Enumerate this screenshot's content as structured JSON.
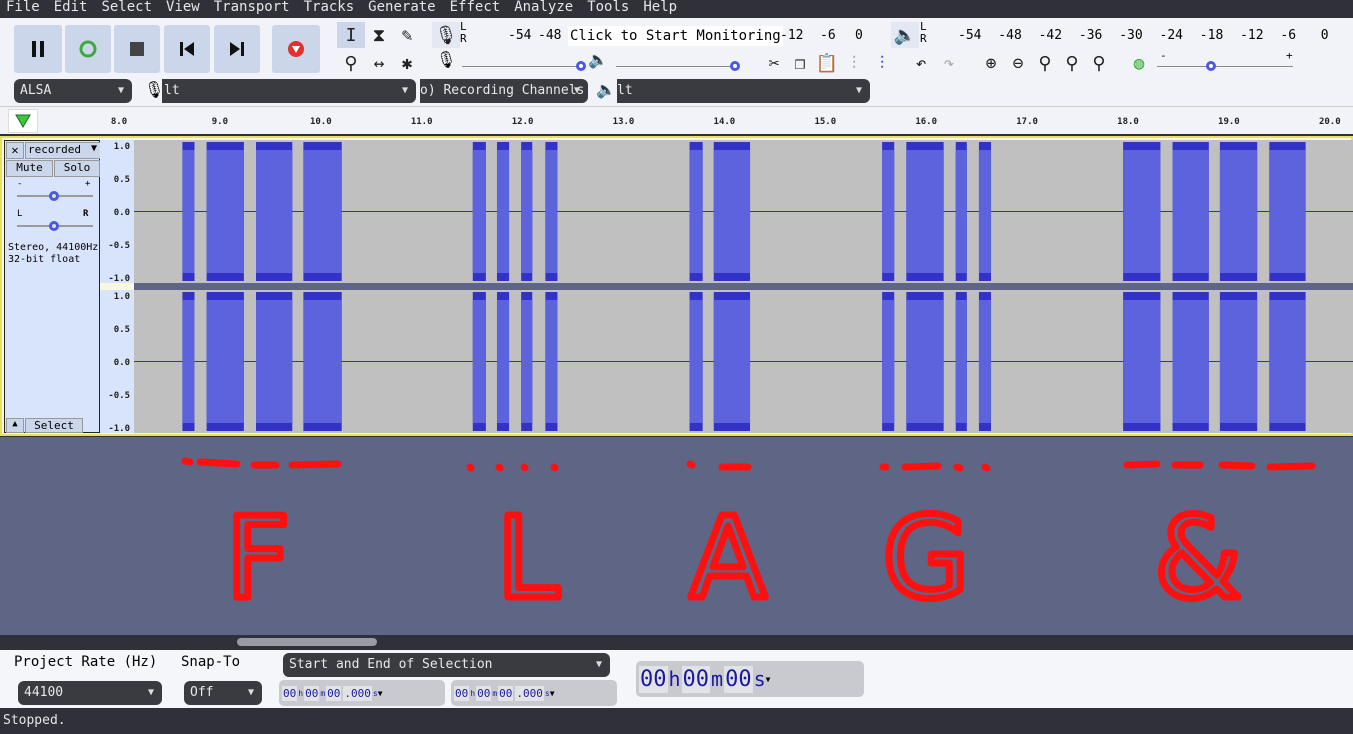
{
  "menu": [
    "File",
    "Edit",
    "Select",
    "View",
    "Transport",
    "Tracks",
    "Generate",
    "Effect",
    "Analyze",
    "Tools",
    "Help"
  ],
  "transport": {
    "pause": "pause-icon",
    "play": "play-loop-icon",
    "stop": "stop-icon",
    "skip_start": "skip-start-icon",
    "skip_end": "skip-end-icon",
    "record": "record-icon"
  },
  "tools": [
    "selection-tool",
    "envelope-tool",
    "draw-tool",
    "zoom-tool",
    "time-shift-tool",
    "multi-tool"
  ],
  "rec_meter": {
    "channels": [
      "L",
      "R"
    ],
    "ticks": [
      "-54",
      "-48",
      "-12",
      "-6",
      "0"
    ],
    "prompt": "Click to Start Monitoring"
  },
  "play_meter": {
    "channels": [
      "L",
      "R"
    ],
    "ticks": [
      "-54",
      "-48",
      "-42",
      "-36",
      "-30",
      "-24",
      "-18",
      "-12",
      "-6",
      "0"
    ]
  },
  "mixer": {
    "rec_volume": 1.0,
    "play_volume": 1.0,
    "minus": "-",
    "plus": "+"
  },
  "play_speed": {
    "minus": "-",
    "plus": "+",
    "value": 0.4
  },
  "devices": {
    "host": "ALSA",
    "rec_device": "lt",
    "rec_channels": "o) Recording Channels",
    "play_device": "lt"
  },
  "ruler": {
    "ticks": [
      "8.0",
      "9.0",
      "10.0",
      "11.0",
      "12.0",
      "13.0",
      "14.0",
      "15.0",
      "16.0",
      "17.0",
      "18.0",
      "19.0",
      "20.0"
    ]
  },
  "track": {
    "name": "recorded",
    "mute": "Mute",
    "solo": "Solo",
    "gain_minus": "-",
    "gain_plus": "+",
    "pan_l": "L",
    "pan_r": "R",
    "info1": "Stereo, 44100Hz",
    "info2": "32-bit float",
    "select": "Select",
    "scale": [
      "1.0",
      "0.5",
      "0.0",
      "-0.5",
      "-1.0"
    ],
    "wave_color": "#5c63dc",
    "view_start": 8.13,
    "view_end": 20.22,
    "clips": [
      [
        8.61,
        8.73
      ],
      [
        8.85,
        9.22
      ],
      [
        9.34,
        9.7
      ],
      [
        9.81,
        10.19
      ],
      [
        11.49,
        11.62
      ],
      [
        11.73,
        11.85
      ],
      [
        11.97,
        12.08
      ],
      [
        12.21,
        12.33
      ],
      [
        13.64,
        13.77
      ],
      [
        13.88,
        14.24
      ],
      [
        15.55,
        15.67
      ],
      [
        15.79,
        16.16
      ],
      [
        16.28,
        16.39
      ],
      [
        16.51,
        16.63
      ],
      [
        17.94,
        18.31
      ],
      [
        18.43,
        18.79
      ],
      [
        18.9,
        19.27
      ],
      [
        19.39,
        19.75
      ]
    ]
  },
  "annotation": {
    "letters": "FLAG&",
    "morse": [
      "..-.",
      ".-..",
      ".-",
      "--.",
      "-...-"
    ],
    "color": "#ff1010"
  },
  "selection": {
    "rate_label": "Project Rate (Hz)",
    "snap_label": "Snap-To",
    "rate": "44100",
    "snap": "Off",
    "mode": "Start and End of Selection",
    "start": [
      "00",
      "h",
      "00",
      "m",
      "00",
      ".000",
      "s"
    ],
    "end": [
      "00",
      "h",
      "00",
      "m",
      "00",
      ".000",
      "s"
    ],
    "audio_pos": [
      "00",
      "h",
      "00",
      "m",
      "00",
      "s"
    ]
  },
  "status": "Stopped."
}
